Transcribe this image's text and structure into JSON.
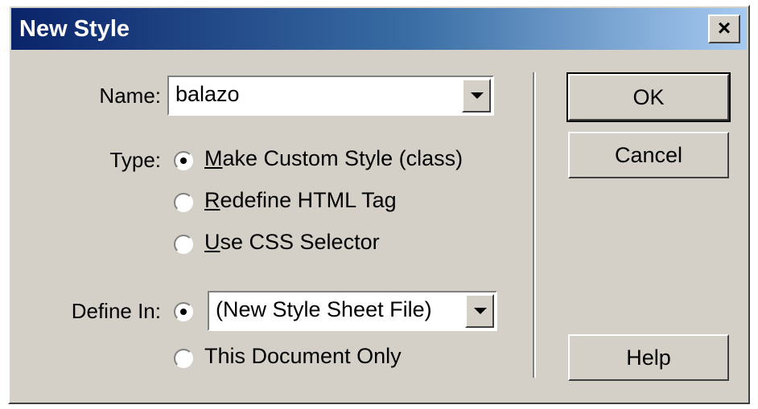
{
  "window": {
    "title": "New Style",
    "close_glyph": "×"
  },
  "name_field": {
    "label": "Name:",
    "value": "balazo"
  },
  "type_group": {
    "label": "Type:",
    "options": [
      {
        "prefix": "",
        "accel": "M",
        "rest": "ake Custom Style (class)",
        "selected": true
      },
      {
        "prefix": "",
        "accel": "R",
        "rest": "edefine HTML Tag",
        "selected": false
      },
      {
        "prefix": "",
        "accel": "U",
        "rest": "se CSS Selector",
        "selected": false
      }
    ]
  },
  "define_in": {
    "label": "Define In:",
    "sheet_value": "(New Style Sheet File)",
    "doc_only_label": "This Document Only",
    "sheet_selected": true
  },
  "buttons": {
    "ok": "OK",
    "cancel": "Cancel",
    "help": "Help"
  }
}
